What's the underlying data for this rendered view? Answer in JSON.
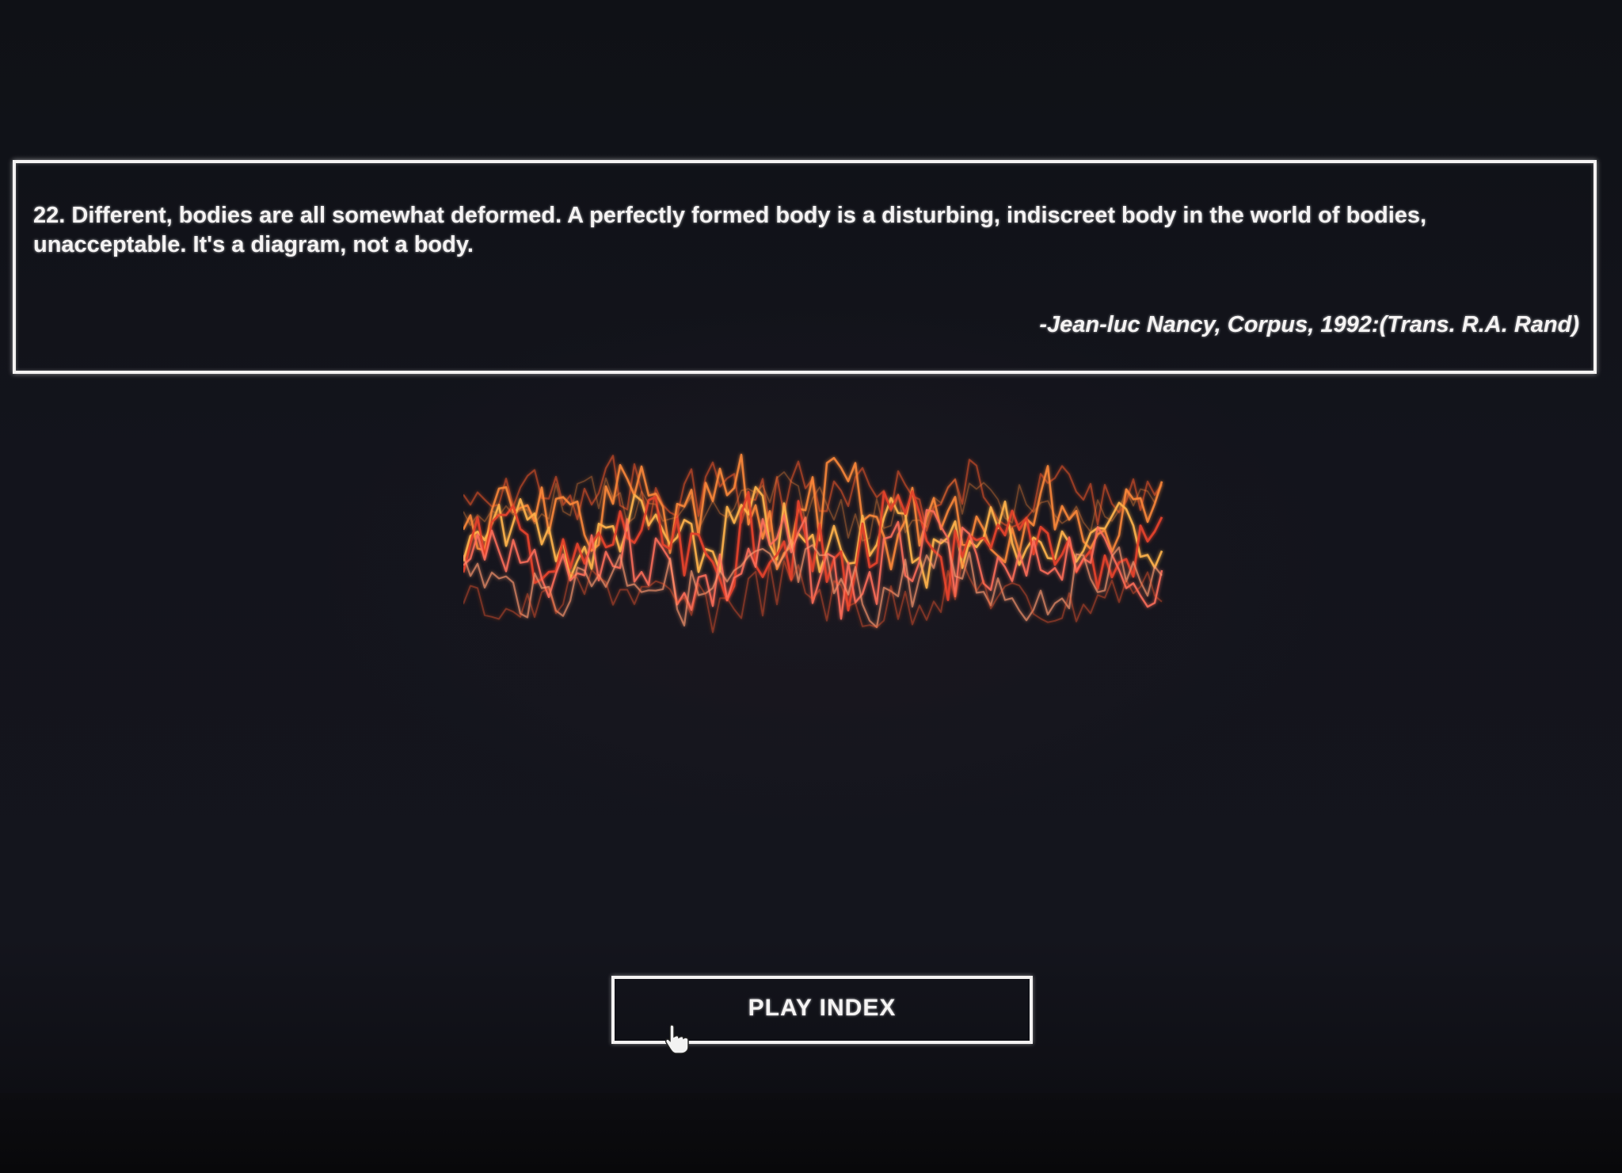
{
  "quote": {
    "text": "22. Different, bodies are all somewhat deformed. A perfectly formed body is a disturbing, indiscreet body in the world of bodies, unacceptable. It's a diagram, not a body.",
    "attribution": "-Jean-luc Nancy, Corpus, 1992:(Trans. R.A. Rand)"
  },
  "controls": {
    "play_label": "PLAY INDEX"
  },
  "waveform": {
    "colors": [
      "#ff5a2a",
      "#ff8a3a",
      "#ffb24a",
      "#e0402a",
      "#ff6f5a",
      "#ff9a70"
    ]
  },
  "icons": {
    "cursor": "hand-pointer-icon"
  }
}
